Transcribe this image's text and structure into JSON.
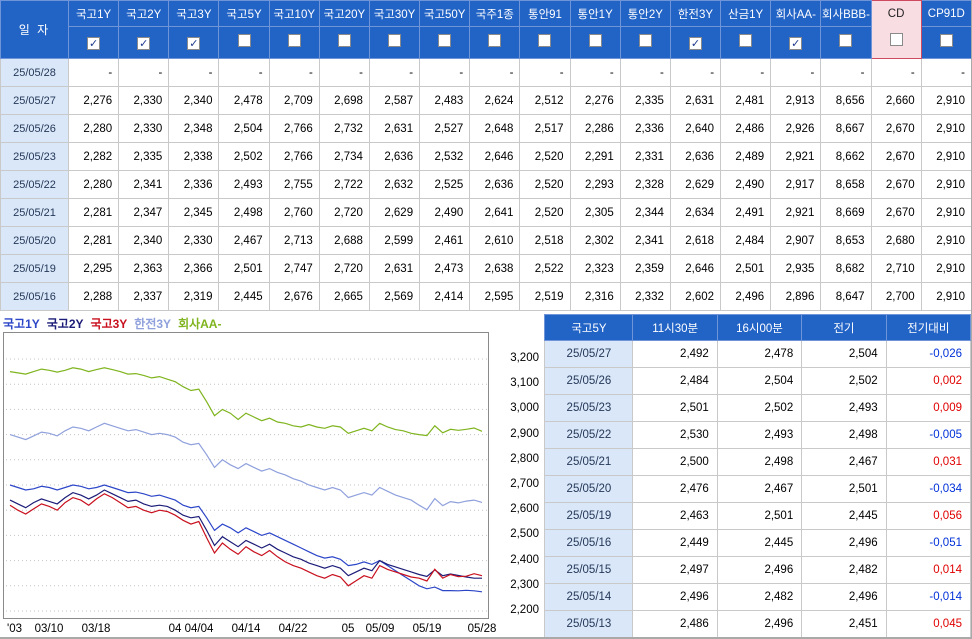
{
  "colors": {
    "header_bg": "#2263c6",
    "date_bg": "#d9e7f8",
    "grid_line": "#c9c9c9",
    "cd_highlight_bg": "#f8dde3",
    "cd_highlight_border": "#cf4a60",
    "positive": "#e00000",
    "negative": "#0031d8"
  },
  "top_table": {
    "date_header": "일 자",
    "columns": [
      {
        "label": "국고1Y",
        "checked": true,
        "highlight": false
      },
      {
        "label": "국고2Y",
        "checked": true,
        "highlight": false
      },
      {
        "label": "국고3Y",
        "checked": true,
        "highlight": false
      },
      {
        "label": "국고5Y",
        "checked": false,
        "highlight": false
      },
      {
        "label": "국고10Y",
        "checked": false,
        "highlight": false
      },
      {
        "label": "국고20Y",
        "checked": false,
        "highlight": false
      },
      {
        "label": "국고30Y",
        "checked": false,
        "highlight": false
      },
      {
        "label": "국고50Y",
        "checked": false,
        "highlight": false
      },
      {
        "label": "국주1종",
        "checked": false,
        "highlight": false
      },
      {
        "label": "통안91",
        "checked": false,
        "highlight": false
      },
      {
        "label": "통안1Y",
        "checked": false,
        "highlight": false
      },
      {
        "label": "통안2Y",
        "checked": false,
        "highlight": false
      },
      {
        "label": "한전3Y",
        "checked": true,
        "highlight": false
      },
      {
        "label": "산금1Y",
        "checked": false,
        "highlight": false
      },
      {
        "label": "회사AA-",
        "checked": true,
        "highlight": false
      },
      {
        "label": "회사BBB-",
        "checked": false,
        "highlight": false
      },
      {
        "label": "CD",
        "checked": false,
        "highlight": true
      },
      {
        "label": "CP91D",
        "checked": false,
        "highlight": false
      }
    ],
    "rows": [
      {
        "date": "25/05/28",
        "values": [
          "-",
          "-",
          "-",
          "-",
          "-",
          "-",
          "-",
          "-",
          "-",
          "-",
          "-",
          "-",
          "-",
          "-",
          "-",
          "-",
          "-",
          "-"
        ]
      },
      {
        "date": "25/05/27",
        "values": [
          "2,276",
          "2,330",
          "2,340",
          "2,478",
          "2,709",
          "2,698",
          "2,587",
          "2,483",
          "2,624",
          "2,512",
          "2,276",
          "2,335",
          "2,631",
          "2,481",
          "2,913",
          "8,656",
          "2,660",
          "2,910"
        ]
      },
      {
        "date": "25/05/26",
        "values": [
          "2,280",
          "2,330",
          "2,348",
          "2,504",
          "2,766",
          "2,732",
          "2,631",
          "2,527",
          "2,648",
          "2,517",
          "2,286",
          "2,336",
          "2,640",
          "2,486",
          "2,926",
          "8,667",
          "2,670",
          "2,910"
        ]
      },
      {
        "date": "25/05/23",
        "values": [
          "2,282",
          "2,335",
          "2,338",
          "2,502",
          "2,766",
          "2,734",
          "2,636",
          "2,532",
          "2,646",
          "2,520",
          "2,291",
          "2,331",
          "2,636",
          "2,489",
          "2,921",
          "8,662",
          "2,670",
          "2,910"
        ]
      },
      {
        "date": "25/05/22",
        "values": [
          "2,280",
          "2,341",
          "2,336",
          "2,493",
          "2,755",
          "2,722",
          "2,632",
          "2,525",
          "2,636",
          "2,520",
          "2,293",
          "2,328",
          "2,629",
          "2,490",
          "2,917",
          "8,658",
          "2,670",
          "2,910"
        ]
      },
      {
        "date": "25/05/21",
        "values": [
          "2,281",
          "2,347",
          "2,345",
          "2,498",
          "2,760",
          "2,720",
          "2,629",
          "2,490",
          "2,641",
          "2,520",
          "2,305",
          "2,344",
          "2,634",
          "2,491",
          "2,921",
          "8,669",
          "2,670",
          "2,910"
        ]
      },
      {
        "date": "25/05/20",
        "values": [
          "2,281",
          "2,340",
          "2,330",
          "2,467",
          "2,713",
          "2,688",
          "2,599",
          "2,461",
          "2,610",
          "2,518",
          "2,302",
          "2,341",
          "2,618",
          "2,484",
          "2,907",
          "8,653",
          "2,680",
          "2,910"
        ]
      },
      {
        "date": "25/05/19",
        "values": [
          "2,295",
          "2,363",
          "2,366",
          "2,501",
          "2,747",
          "2,720",
          "2,631",
          "2,473",
          "2,638",
          "2,522",
          "2,323",
          "2,359",
          "2,646",
          "2,501",
          "2,935",
          "8,682",
          "2,710",
          "2,910"
        ]
      },
      {
        "date": "25/05/16",
        "values": [
          "2,288",
          "2,337",
          "2,319",
          "2,445",
          "2,676",
          "2,665",
          "2,569",
          "2,414",
          "2,595",
          "2,519",
          "2,316",
          "2,332",
          "2,602",
          "2,496",
          "2,896",
          "8,647",
          "2,700",
          "2,910"
        ]
      }
    ]
  },
  "chart_data": {
    "type": "line",
    "title": "",
    "xlabel": "",
    "ylabel": "",
    "ylim": [
      2200,
      3200
    ],
    "grid": "horizontal-dotted",
    "legend_position": "top-left",
    "yticks": [
      {
        "value": 3200,
        "label": "3,200"
      },
      {
        "value": 3100,
        "label": "3,100"
      },
      {
        "value": 3000,
        "label": "3,000"
      },
      {
        "value": 2900,
        "label": "2,900"
      },
      {
        "value": 2800,
        "label": "2,800"
      },
      {
        "value": 2700,
        "label": "2,700"
      },
      {
        "value": 2600,
        "label": "2,600"
      },
      {
        "value": 2500,
        "label": "2,500"
      },
      {
        "value": 2400,
        "label": "2,400"
      },
      {
        "value": 2300,
        "label": "2,300"
      },
      {
        "value": 2200,
        "label": "2,200"
      }
    ],
    "xticks": [
      {
        "label": "'03",
        "pos": 0
      },
      {
        "label": "03/10",
        "pos": 0.083
      },
      {
        "label": "03/18",
        "pos": 0.183
      },
      {
        "label": "04",
        "pos": 0.35
      },
      {
        "label": "04/04",
        "pos": 0.4
      },
      {
        "label": "04/14",
        "pos": 0.5
      },
      {
        "label": "04/22",
        "pos": 0.6
      },
      {
        "label": "05",
        "pos": 0.717
      },
      {
        "label": "05/09",
        "pos": 0.783
      },
      {
        "label": "05/19",
        "pos": 0.883
      },
      {
        "label": "05/28",
        "pos": 1.0
      }
    ],
    "series": [
      {
        "name": "국고1Y",
        "color": "#2c46c8",
        "values": [
          2700,
          2690,
          2680,
          2685,
          2695,
          2690,
          2680,
          2690,
          2700,
          2695,
          2685,
          2690,
          2700,
          2690,
          2680,
          2670,
          2672,
          2665,
          2655,
          2660,
          2650,
          2640,
          2620,
          2610,
          2615,
          2570,
          2520,
          2545,
          2530,
          2510,
          2530,
          2515,
          2500,
          2510,
          2495,
          2480,
          2465,
          2450,
          2435,
          2420,
          2410,
          2415,
          2405,
          2380,
          2385,
          2395,
          2385,
          2400,
          2380,
          2360,
          2340,
          2320,
          2300,
          2288,
          2295,
          2281,
          2281,
          2280,
          2282,
          2280,
          2276
        ]
      },
      {
        "name": "국고2Y",
        "color": "#1c1c78",
        "values": [
          2640,
          2625,
          2610,
          2630,
          2645,
          2635,
          2625,
          2650,
          2670,
          2660,
          2645,
          2660,
          2680,
          2665,
          2650,
          2635,
          2640,
          2625,
          2615,
          2620,
          2615,
          2600,
          2580,
          2570,
          2575,
          2520,
          2460,
          2495,
          2475,
          2455,
          2480,
          2465,
          2450,
          2465,
          2445,
          2430,
          2415,
          2405,
          2390,
          2380,
          2370,
          2380,
          2370,
          2340,
          2355,
          2370,
          2360,
          2400,
          2385,
          2375,
          2365,
          2355,
          2345,
          2337,
          2363,
          2340,
          2347,
          2341,
          2335,
          2330,
          2330
        ]
      },
      {
        "name": "국고3Y",
        "color": "#c8101e",
        "values": [
          2620,
          2600,
          2585,
          2605,
          2625,
          2615,
          2600,
          2630,
          2650,
          2640,
          2620,
          2645,
          2665,
          2650,
          2630,
          2610,
          2615,
          2600,
          2590,
          2600,
          2595,
          2580,
          2560,
          2545,
          2555,
          2490,
          2430,
          2470,
          2445,
          2425,
          2455,
          2435,
          2420,
          2440,
          2415,
          2395,
          2380,
          2370,
          2355,
          2340,
          2330,
          2345,
          2335,
          2300,
          2320,
          2340,
          2330,
          2380,
          2365,
          2355,
          2345,
          2335,
          2330,
          2319,
          2366,
          2330,
          2345,
          2336,
          2338,
          2348,
          2340
        ]
      },
      {
        "name": "한전3Y",
        "color": "#8fa0dc",
        "values": [
          2900,
          2890,
          2880,
          2895,
          2910,
          2905,
          2895,
          2915,
          2930,
          2925,
          2915,
          2930,
          2945,
          2935,
          2925,
          2915,
          2920,
          2910,
          2900,
          2905,
          2900,
          2890,
          2870,
          2860,
          2865,
          2820,
          2770,
          2800,
          2780,
          2765,
          2785,
          2770,
          2755,
          2765,
          2750,
          2740,
          2725,
          2715,
          2700,
          2690,
          2680,
          2690,
          2680,
          2650,
          2660,
          2670,
          2660,
          2690,
          2675,
          2660,
          2650,
          2640,
          2620,
          2602,
          2646,
          2618,
          2634,
          2629,
          2636,
          2640,
          2631
        ]
      },
      {
        "name": "회사AA-",
        "color": "#7fb41e",
        "values": [
          3150,
          3145,
          3140,
          3150,
          3160,
          3155,
          3148,
          3155,
          3165,
          3160,
          3150,
          3158,
          3165,
          3158,
          3150,
          3140,
          3142,
          3135,
          3125,
          3130,
          3120,
          3110,
          3090,
          3075,
          3080,
          3030,
          2975,
          3000,
          2985,
          2960,
          2985,
          2970,
          2955,
          2965,
          2950,
          2945,
          2935,
          2930,
          2940,
          2930,
          2925,
          2935,
          2930,
          2905,
          2915,
          2925,
          2915,
          2945,
          2930,
          2920,
          2915,
          2905,
          2900,
          2896,
          2935,
          2907,
          2921,
          2917,
          2921,
          2926,
          2913
        ]
      }
    ]
  },
  "right_table": {
    "headers": [
      "국고5Y",
      "11시30분",
      "16시00분",
      "전기",
      "전기대비"
    ],
    "rows": [
      {
        "date": "25/05/27",
        "values": [
          "2,492",
          "2,478",
          "2,504",
          "-0,026"
        ]
      },
      {
        "date": "25/05/26",
        "values": [
          "2,484",
          "2,504",
          "2,502",
          "0,002"
        ]
      },
      {
        "date": "25/05/23",
        "values": [
          "2,501",
          "2,502",
          "2,493",
          "0,009"
        ]
      },
      {
        "date": "25/05/22",
        "values": [
          "2,530",
          "2,493",
          "2,498",
          "-0,005"
        ]
      },
      {
        "date": "25/05/21",
        "values": [
          "2,500",
          "2,498",
          "2,467",
          "0,031"
        ]
      },
      {
        "date": "25/05/20",
        "values": [
          "2,476",
          "2,467",
          "2,501",
          "-0,034"
        ]
      },
      {
        "date": "25/05/19",
        "values": [
          "2,463",
          "2,501",
          "2,445",
          "0,056"
        ]
      },
      {
        "date": "25/05/16",
        "values": [
          "2,449",
          "2,445",
          "2,496",
          "-0,051"
        ]
      },
      {
        "date": "25/05/15",
        "values": [
          "2,497",
          "2,496",
          "2,482",
          "0,014"
        ]
      },
      {
        "date": "25/05/14",
        "values": [
          "2,496",
          "2,482",
          "2,496",
          "-0,014"
        ]
      },
      {
        "date": "25/05/13",
        "values": [
          "2,486",
          "2,496",
          "2,451",
          "0,045"
        ]
      }
    ]
  }
}
